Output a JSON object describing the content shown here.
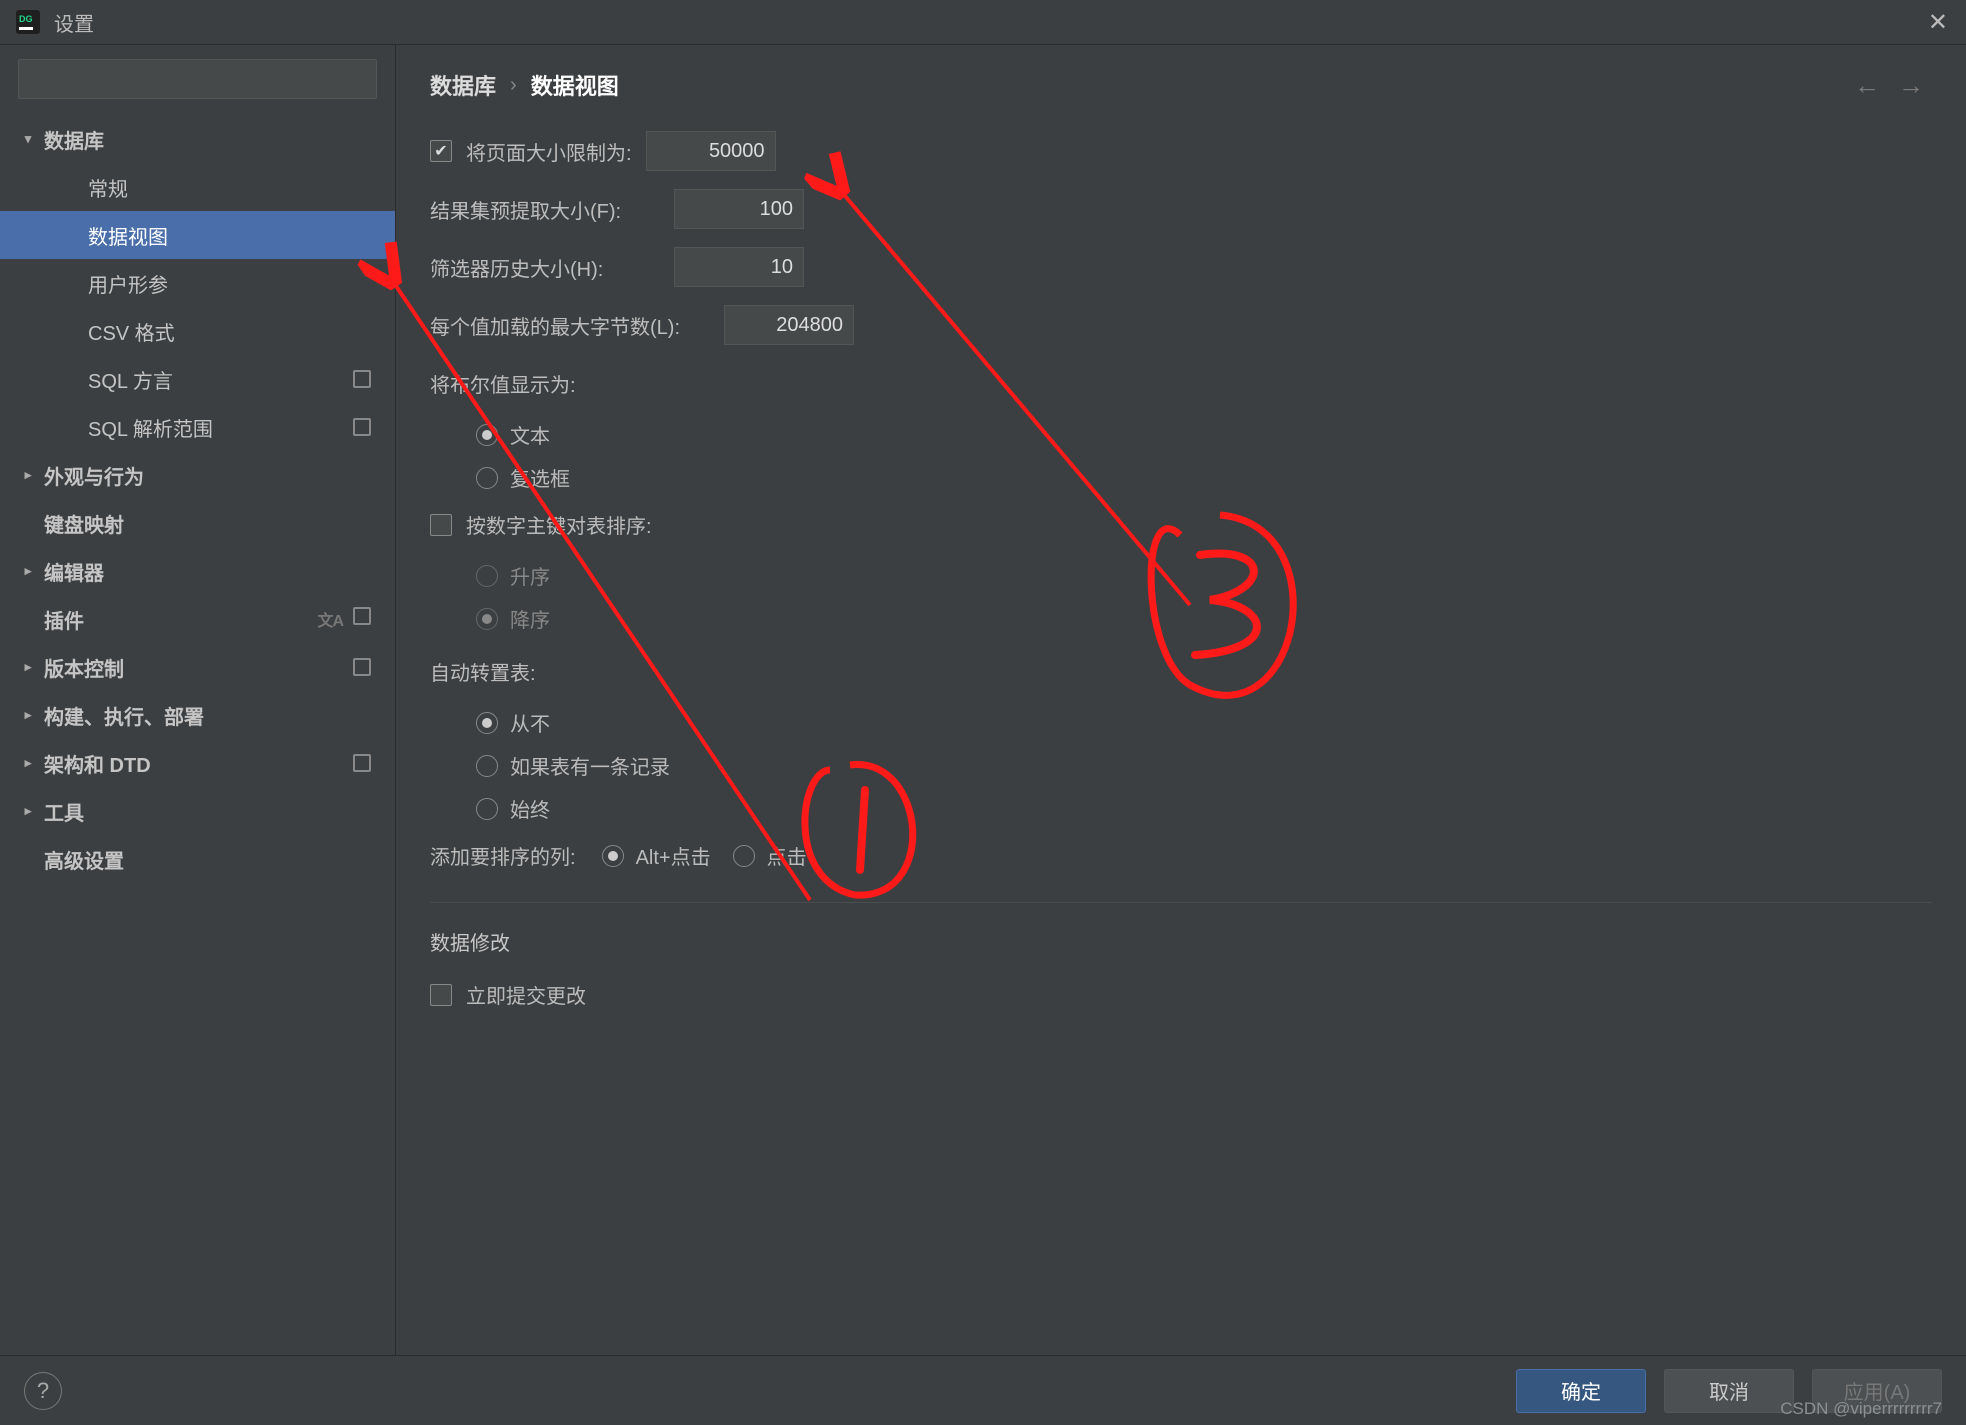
{
  "window": {
    "title": "设置"
  },
  "search": {
    "placeholder": ""
  },
  "tree": {
    "database": "数据库",
    "items": [
      "常规",
      "数据视图",
      "用户形参",
      "CSV 格式",
      "SQL 方言",
      "SQL 解析范围"
    ],
    "appearance": "外观与行为",
    "keymap": "键盘映射",
    "editor": "编辑器",
    "plugins": "插件",
    "vcs": "版本控制",
    "build": "构建、执行、部署",
    "dtd": "架构和 DTD",
    "tools": "工具",
    "advanced": "高级设置"
  },
  "crumbs": {
    "root": "数据库",
    "current": "数据视图"
  },
  "fields": {
    "limit_label": "将页面大小限制为:",
    "limit_value": "50000",
    "prefetch_label": "结果集预提取大小(F):",
    "prefetch_value": "100",
    "filter_hist_label": "筛选器历史大小(H):",
    "filter_hist_value": "10",
    "maxbytes_label": "每个值加载的最大字节数(L):",
    "maxbytes_value": "204800"
  },
  "bool_display": {
    "label": "将布尔值显示为:",
    "opts": [
      "文本",
      "复选框"
    ]
  },
  "pk_sort": {
    "label": "按数字主键对表排序:",
    "opts": [
      "升序",
      "降序"
    ]
  },
  "transpose": {
    "label": "自动转置表:",
    "opts": [
      "从不",
      "如果表有一条记录",
      "始终"
    ]
  },
  "add_sort_col": {
    "label": "添加要排序的列:",
    "opts": [
      "Alt+点击",
      "点击"
    ]
  },
  "modify": {
    "title": "数据修改",
    "immediate": "立即提交更改"
  },
  "buttons": {
    "ok": "确定",
    "cancel": "取消",
    "apply": "应用(A)"
  },
  "watermark": "CSDN @viperrrrrrrrr7"
}
